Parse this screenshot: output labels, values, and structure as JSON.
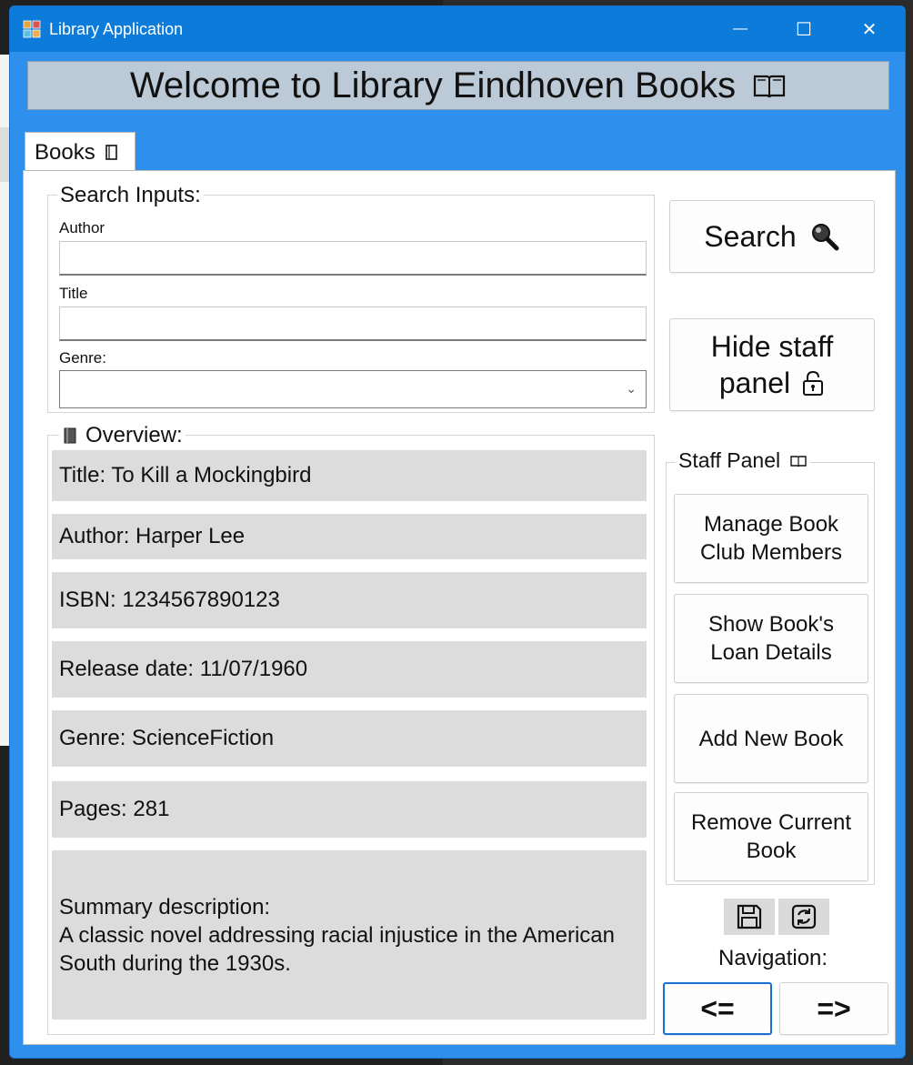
{
  "window": {
    "title": "Library Application",
    "controls": {
      "minimize": "—",
      "maximize": "☐",
      "close": "✕"
    }
  },
  "banner": {
    "text": "Welcome to Library Eindhoven Books"
  },
  "tabs": [
    {
      "label": "Books"
    }
  ],
  "search": {
    "group_title": "Search Inputs:",
    "author_label": "Author",
    "author_value": "",
    "title_label": "Title",
    "title_value": "",
    "genre_label": "Genre:",
    "genre_value": "",
    "search_button": "Search"
  },
  "staff_toggle": {
    "line1": "Hide staff",
    "line2": "panel"
  },
  "overview": {
    "group_title": "Overview:",
    "title": "Title: To Kill a Mockingbird",
    "author": "Author: Harper Lee",
    "isbn": "ISBN: 1234567890123",
    "release_date": "Release date: 11/07/1960",
    "genre": "Genre: ScienceFiction",
    "pages": "Pages: 281",
    "summary_label": "Summary description:",
    "summary_text": "A classic novel addressing racial injustice in the American South during the 1930s."
  },
  "staff_panel": {
    "title": "Staff Panel",
    "buttons": [
      {
        "line1": "Manage Book",
        "line2": "Club Members"
      },
      {
        "line1": "Show Book's",
        "line2": "Loan Details"
      },
      {
        "line1": "Add New Book",
        "line2": ""
      },
      {
        "line1": "Remove Current",
        "line2": "Book"
      }
    ]
  },
  "navigation": {
    "label": "Navigation:",
    "prev": "<=",
    "next": "=>"
  },
  "colors": {
    "window_frame": "#2e8fec",
    "title_bar": "#0c7bd9",
    "banner_bg": "#bcc9d6",
    "info_bg": "#dcdcdc",
    "nav_focus": "#1a6fd0"
  }
}
